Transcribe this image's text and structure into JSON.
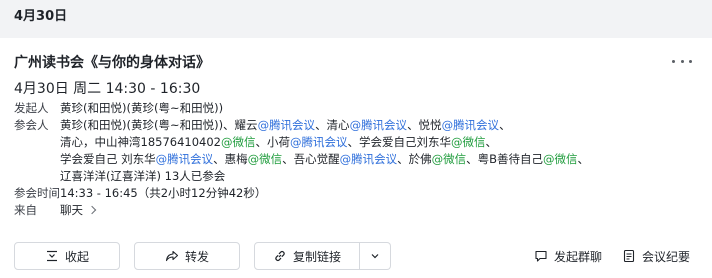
{
  "date_header": "4月30日",
  "event": {
    "title": "广州读书会《与你的身体对话》",
    "time": "4月30日 周二 14:30 - 16:30",
    "organizer_label": "发起人",
    "organizer": "黄珍(和田悦)(黄珍(粤~和田悦))",
    "attendees_label": "参会人",
    "attendee_lines": [
      [
        {
          "text": "黄珍(和田悦)(黄珍(粤~和田悦))、耀云",
          "color": ""
        },
        {
          "text": "@腾讯会议",
          "color": "blue"
        },
        {
          "text": "、清心",
          "color": ""
        },
        {
          "text": "@腾讯会议",
          "color": "blue"
        },
        {
          "text": "、悦悦",
          "color": ""
        },
        {
          "text": "@腾讯会议",
          "color": "blue"
        },
        {
          "text": "、",
          "color": ""
        }
      ],
      [
        {
          "text": "清心，中山神湾18576410402",
          "color": ""
        },
        {
          "text": "@微信",
          "color": "green"
        },
        {
          "text": "、小荷",
          "color": ""
        },
        {
          "text": "@腾讯会议",
          "color": "blue"
        },
        {
          "text": "、学会爱自己刘东华",
          "color": ""
        },
        {
          "text": "@微信",
          "color": "green"
        },
        {
          "text": "、",
          "color": ""
        }
      ],
      [
        {
          "text": "学会爱自己 刘东华",
          "color": ""
        },
        {
          "text": "@腾讯会议",
          "color": "blue"
        },
        {
          "text": "、惠梅",
          "color": ""
        },
        {
          "text": "@微信",
          "color": "green"
        },
        {
          "text": "、吾心觉醒",
          "color": ""
        },
        {
          "text": "@腾讯会议",
          "color": "blue"
        },
        {
          "text": "、於佛",
          "color": ""
        },
        {
          "text": "@微信",
          "color": "green"
        },
        {
          "text": "、粤B善待自己",
          "color": ""
        },
        {
          "text": "@微信",
          "color": "green"
        },
        {
          "text": "、",
          "color": ""
        }
      ],
      [
        {
          "text": "辽喜洋洋(辽喜洋洋) 13人已参会",
          "color": ""
        }
      ]
    ],
    "attend_time_label": "参会时间",
    "attend_time": "14:33 - 16:45（共2小时12分钟42秒）",
    "source_label": "来自",
    "source": "聊天"
  },
  "actions": {
    "collapse": "收起",
    "forward": "转发",
    "copy_link": "复制链接",
    "start_chat": "发起群聊",
    "minutes": "会议纪要"
  },
  "colors": {
    "blue": "#2f6fdb",
    "green": "#1f9c3c"
  },
  "icons": [
    "more-icon",
    "collapse-icon",
    "forward-icon",
    "copy-link-icon",
    "chevron-down-icon",
    "chat-icon",
    "minutes-icon",
    "chevron-right-icon"
  ]
}
